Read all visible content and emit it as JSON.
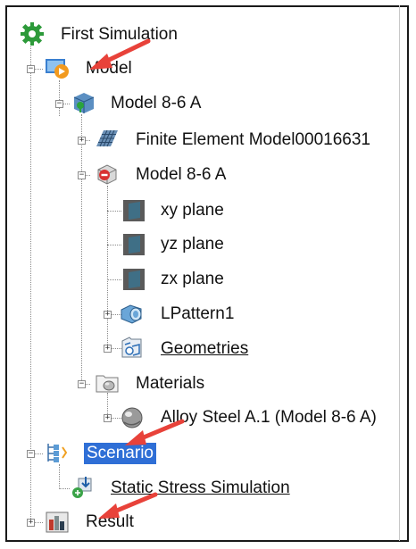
{
  "tree": {
    "root": {
      "label": "First Simulation",
      "icon": "gear-icon"
    },
    "model": {
      "label": "Model",
      "icon": "model-icon"
    },
    "part": {
      "label": "Model 8-6 A",
      "icon": "part-icon"
    },
    "fem": {
      "label": "Finite Element Model00016631",
      "icon": "mesh-icon"
    },
    "body": {
      "label": "Model 8-6 A",
      "icon": "body-icon"
    },
    "planes": [
      {
        "label": "xy plane",
        "icon": "plane-icon"
      },
      {
        "label": "yz plane",
        "icon": "plane-icon"
      },
      {
        "label": "zx plane",
        "icon": "plane-icon"
      }
    ],
    "pattern": {
      "label": "LPattern1",
      "icon": "pattern-icon"
    },
    "geometries": {
      "label": "Geometries",
      "icon": "geometries-icon"
    },
    "materials": {
      "label": "Materials",
      "icon": "folder-icon"
    },
    "alloy": {
      "label": "Alloy Steel A.1 (Model 8-6 A)",
      "icon": "material-sphere-icon"
    },
    "scenario": {
      "label": "Scenario",
      "icon": "scenario-icon"
    },
    "static": {
      "label": "Static Stress Simulation",
      "icon": "static-stress-icon"
    },
    "result": {
      "label": "Result",
      "icon": "result-icon"
    }
  },
  "colors": {
    "selection": "#2f6fd6",
    "arrow": "#e8423a"
  }
}
